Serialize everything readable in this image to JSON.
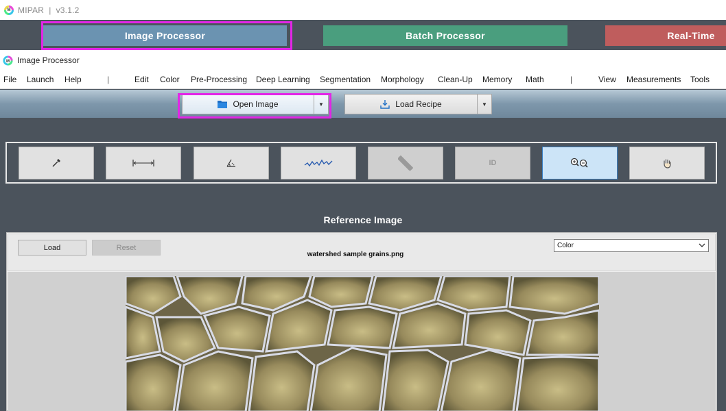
{
  "app": {
    "name": "MIPAR",
    "separator": "|",
    "version": "v3.1.2"
  },
  "modes": [
    {
      "label": "Image Processor",
      "color": "#6b93b1"
    },
    {
      "label": "Batch Processor",
      "color": "#4a9e7e"
    },
    {
      "label": "Real-Time",
      "color": "#bf5d5d"
    }
  ],
  "window": {
    "title": "Image Processor"
  },
  "menu": {
    "left": [
      "File",
      "Launch",
      "Help"
    ],
    "middle": [
      "Edit",
      "Color",
      "Pre-Processing",
      "Deep Learning",
      "Segmentation",
      "Morphology",
      "Clean-Up",
      "Memory",
      "Math"
    ],
    "right": [
      "View",
      "Measurements",
      "Tools"
    ],
    "separator": "|"
  },
  "toolbar": {
    "open_image": "Open Image",
    "load_recipe": "Load Recipe"
  },
  "tools": [
    {
      "icon": "eyedropper-icon",
      "state": "normal"
    },
    {
      "icon": "measure-distance-icon",
      "state": "normal"
    },
    {
      "icon": "measure-angle-icon",
      "state": "normal"
    },
    {
      "icon": "line-profile-icon",
      "state": "normal"
    },
    {
      "icon": "ruler-icon",
      "state": "disabled"
    },
    {
      "icon": "id-icon",
      "label": "ID",
      "state": "disabled"
    },
    {
      "icon": "zoom-icon",
      "state": "active"
    },
    {
      "icon": "pan-hand-icon",
      "state": "normal"
    }
  ],
  "reference": {
    "heading": "Reference Image",
    "load_label": "Load",
    "reset_label": "Reset",
    "filename": "watershed  sample grains.png",
    "view_mode": "Color"
  },
  "colors": {
    "highlight": "#e325e7",
    "background": "#4b535c",
    "active_tool": "#cce4f7"
  }
}
